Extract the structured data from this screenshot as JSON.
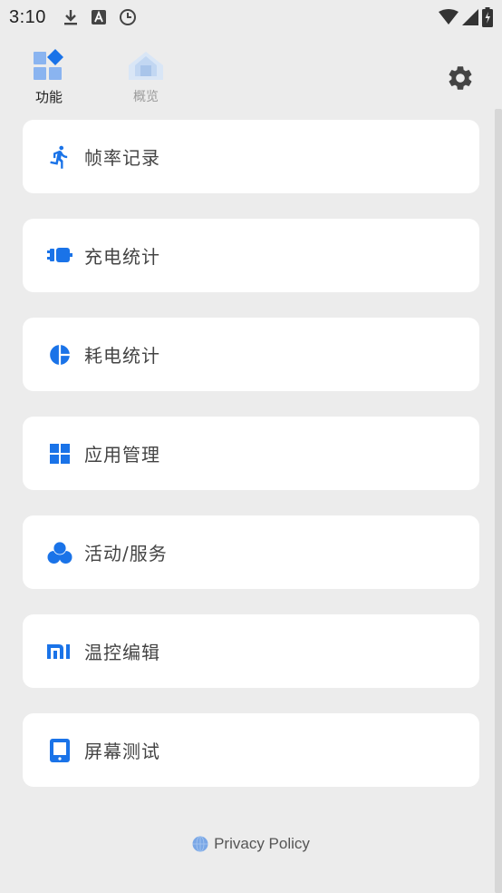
{
  "status_bar": {
    "time": "3:10",
    "left_icons": [
      "download-icon",
      "font-a-icon",
      "clock-icon"
    ],
    "right_icons": [
      "wifi-icon",
      "signal-icon",
      "battery-icon"
    ]
  },
  "tabs": [
    {
      "label": "功能",
      "icon": "grid-diamond-icon",
      "active": true
    },
    {
      "label": "概览",
      "icon": "home-icon",
      "active": false
    }
  ],
  "settings": {
    "icon": "gear-icon"
  },
  "menu_items": [
    {
      "label": "帧率记录",
      "icon": "running-icon"
    },
    {
      "label": "充电统计",
      "icon": "charger-icon"
    },
    {
      "label": "耗电统计",
      "icon": "pie-chart-icon"
    },
    {
      "label": "应用管理",
      "icon": "apps-grid-icon"
    },
    {
      "label": "活动/服务",
      "icon": "bubbles-icon"
    },
    {
      "label": "温控编辑",
      "icon": "mi-logo-icon"
    },
    {
      "label": "屏幕测试",
      "icon": "tablet-icon"
    }
  ],
  "footer": {
    "privacy_label": "Privacy Policy",
    "icon": "globe-icon"
  },
  "colors": {
    "accent": "#1a73e8",
    "background": "#ececec",
    "card": "#ffffff"
  }
}
